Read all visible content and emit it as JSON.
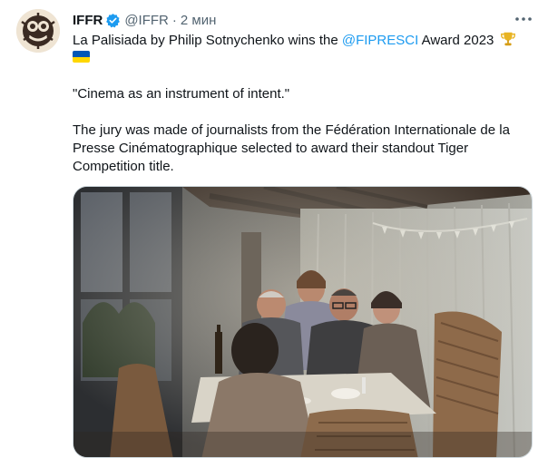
{
  "tweet": {
    "author_name": "IFFR",
    "handle": "@IFFR",
    "separator": "·",
    "time": "2 мин",
    "line1_pre": "La Palisiada by Philip Sotnychenko wins the ",
    "mention": "@FIPRESCI",
    "line1_post": " Award 2023",
    "quote": "\"Cinema as an instrument of intent.\"",
    "body": "The jury was made of journalists from the Fédération Internationale de la Presse Cinématographique selected to award their standout Tiger Competition title.",
    "icons": {
      "verified": "verified-badge-icon",
      "trophy": "trophy-icon",
      "flag": "ukraine-flag-icon",
      "more": "more-options-icon"
    },
    "colors": {
      "accent": "#1d9bf0",
      "secondary_text": "#536471",
      "primary_text": "#0f1419"
    }
  }
}
